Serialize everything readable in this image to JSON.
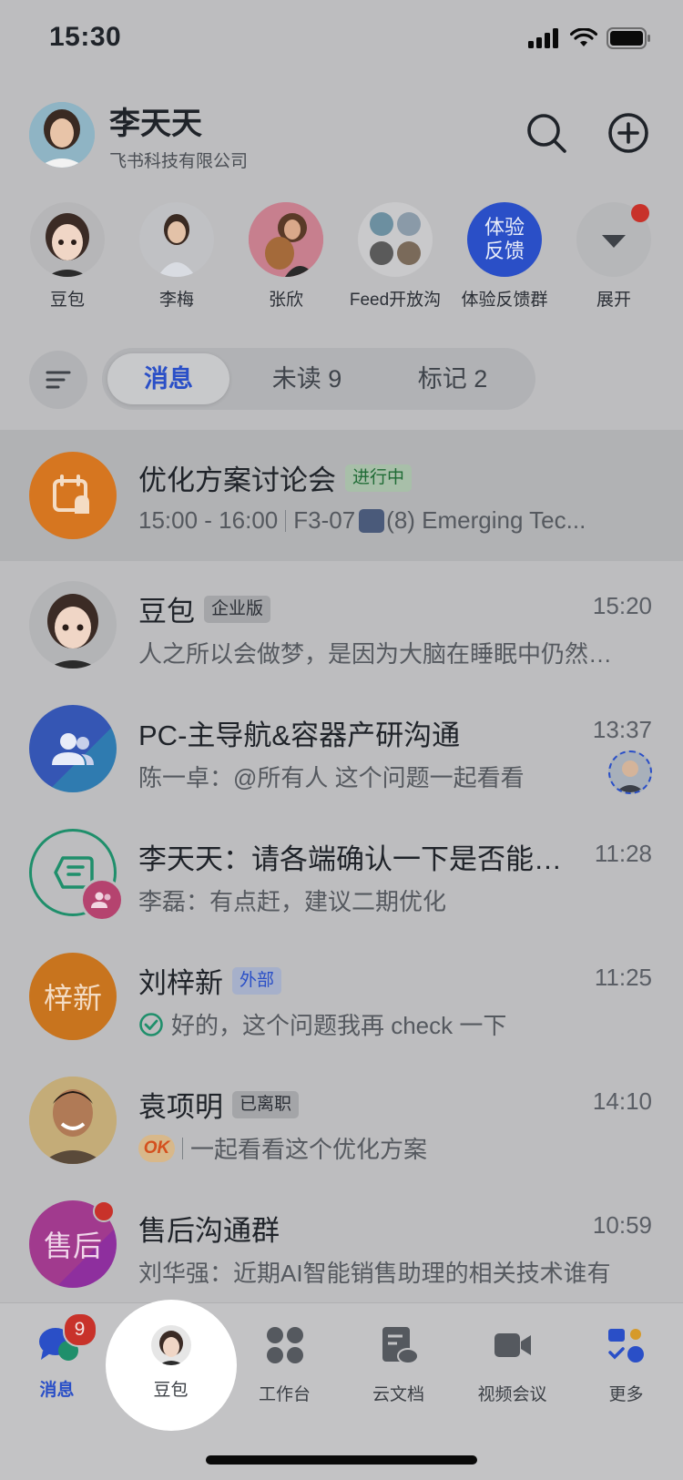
{
  "status": {
    "time": "15:30"
  },
  "header": {
    "name": "李天天",
    "company": "飞书科技有限公司"
  },
  "quick": [
    {
      "label": "豆包"
    },
    {
      "label": "李梅"
    },
    {
      "label": "张欣"
    },
    {
      "label": "Feed开放沟"
    },
    {
      "label": "体验反馈群",
      "avatar_text": "体验\n反馈"
    },
    {
      "label": "展开"
    }
  ],
  "segments": [
    {
      "label": "消息"
    },
    {
      "label": "未读 9"
    },
    {
      "label": "标记 2"
    }
  ],
  "meeting": {
    "title": "优化方案讨论会",
    "tag": "进行中",
    "time_range": "15:00 - 16:00",
    "room": "F3-07",
    "room_extra": "(8) Emerging Tec..."
  },
  "chats": [
    {
      "title": "豆包",
      "tag": "企业版",
      "time": "15:20",
      "preview": "人之所以会做梦，是因为大脑在睡眠中仍然…"
    },
    {
      "title": "PC-主导航&容器产研沟通",
      "time": "13:37",
      "preview": "陈一卓：@所有人 这个问题一起看看"
    },
    {
      "title": "李天天：请各端确认一下是否能…",
      "time": "11:28",
      "preview": "李磊：有点赶，建议二期优化"
    },
    {
      "title": "刘梓新",
      "tag": "外部",
      "avatar_text": "梓新",
      "time": "11:25",
      "preview": "好的，这个问题我再 check 一下"
    },
    {
      "title": "袁项明",
      "tag": "已离职",
      "time": "14:10",
      "ok": "OK",
      "preview": "一起看看这个优化方案"
    },
    {
      "title": "售后沟通群",
      "avatar_text": "售后",
      "time": "10:59",
      "preview": "刘华强：近期AI智能销售助理的相关技术谁有"
    }
  ],
  "tabs": [
    {
      "label": "消息",
      "badge": "9"
    },
    {
      "label": "豆包"
    },
    {
      "label": "工作台"
    },
    {
      "label": "云文档"
    },
    {
      "label": "视频会议"
    },
    {
      "label": "更多"
    }
  ],
  "colors": {
    "accent": "#2a4fc7",
    "meeting_orange": "#d67620",
    "unread_red": "#c8322a",
    "green": "#1f8f6b"
  }
}
